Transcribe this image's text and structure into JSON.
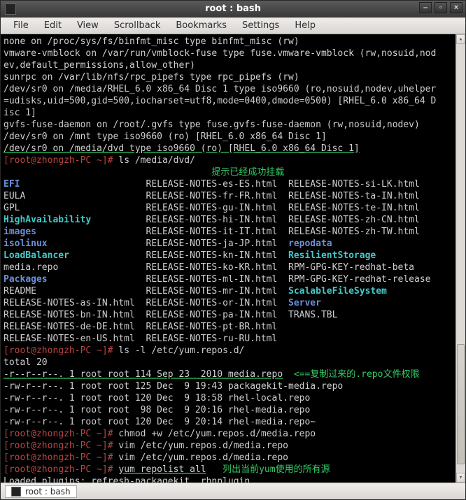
{
  "window": {
    "title": "root : bash"
  },
  "menubar": [
    "File",
    "Edit",
    "View",
    "Scrollback",
    "Bookmarks",
    "Settings",
    "Help"
  ],
  "terminal": {
    "pre_lines": [
      "none on /proc/sys/fs/binfmt_misc type binfmt_misc (rw)",
      "vmware-vmblock on /var/run/vmblock-fuse type fuse.vmware-vmblock (rw,nosuid,nodev,default_permissions,allow_other)",
      "sunrpc on /var/lib/nfs/rpc_pipefs type rpc_pipefs (rw)",
      "/dev/sr0 on /media/RHEL_6.0 x86_64 Disc 1 type iso9660 (ro,nosuid,nodev,uhelper=udisks,uid=500,gid=500,iocharset=utf8,mode=0400,dmode=0500) [RHEL_6.0 x86_64 Disc 1]",
      "gvfs-fuse-daemon on /root/.gvfs type fuse.gvfs-fuse-daemon (rw,nosuid,nodev)",
      "/dev/sr0 on /mnt type iso9660 (ro) [RHEL_6.0 x86_64 Disc 1]"
    ],
    "mount_underlined": "/dev/sr0 on /media/dvd type iso9660 (ro) [RHEL_6.0 x86_64 Disc 1]",
    "prompt1_cmd": "ls /media/dvd/",
    "annotation1_arrow": "<==",
    "annotation1": "提示已经成功挂载",
    "listing": [
      [
        "dir",
        "EFI",
        "plain",
        "RELEASE-NOTES-es-ES.html",
        "plain",
        "RELEASE-NOTES-si-LK.html"
      ],
      [
        "plain",
        "EULA",
        "plain",
        "RELEASE-NOTES-fr-FR.html",
        "plain",
        "RELEASE-NOTES-ta-IN.html"
      ],
      [
        "plain",
        "GPL",
        "plain",
        "RELEASE-NOTES-gu-IN.html",
        "plain",
        "RELEASE-NOTES-te-IN.html"
      ],
      [
        "cyan",
        "HighAvailability",
        "plain",
        "RELEASE-NOTES-hi-IN.html",
        "plain",
        "RELEASE-NOTES-zh-CN.html"
      ],
      [
        "dir",
        "images",
        "plain",
        "RELEASE-NOTES-it-IT.html",
        "plain",
        "RELEASE-NOTES-zh-TW.html"
      ],
      [
        "dir",
        "isolinux",
        "plain",
        "RELEASE-NOTES-ja-JP.html",
        "dir",
        "repodata"
      ],
      [
        "cyan",
        "LoadBalancer",
        "plain",
        "RELEASE-NOTES-kn-IN.html",
        "cyan",
        "ResilientStorage"
      ],
      [
        "plain",
        "media.repo",
        "plain",
        "RELEASE-NOTES-ko-KR.html",
        "plain",
        "RPM-GPG-KEY-redhat-beta"
      ],
      [
        "dir",
        "Packages",
        "plain",
        "RELEASE-NOTES-ml-IN.html",
        "plain",
        "RPM-GPG-KEY-redhat-release"
      ],
      [
        "plain",
        "README",
        "plain",
        "RELEASE-NOTES-mr-IN.html",
        "cyan",
        "ScalableFileSystem"
      ],
      [
        "plain",
        "RELEASE-NOTES-as-IN.html",
        "plain",
        "RELEASE-NOTES-or-IN.html",
        "dir",
        "Server"
      ],
      [
        "plain",
        "RELEASE-NOTES-bn-IN.html",
        "plain",
        "RELEASE-NOTES-pa-IN.html",
        "plain",
        "TRANS.TBL"
      ],
      [
        "plain",
        "RELEASE-NOTES-de-DE.html",
        "plain",
        "RELEASE-NOTES-pt-BR.html",
        "",
        ""
      ],
      [
        "plain",
        "RELEASE-NOTES-en-US.html",
        "plain",
        "RELEASE-NOTES-ru-RU.html",
        "",
        ""
      ]
    ],
    "prompt2_cmd": "ls -l /etc/yum.repos.d/",
    "total_line": "total 20",
    "perm_underlined": "-r--r--r--. 1 root root 114 Sep 23  2010 media.repo",
    "annotation2_arrow": "<==",
    "annotation2": "复制过来的.repo文件权限",
    "perm_lines": [
      "-rw-r--r--. 1 root root 125 Dec  9 19:43 packagekit-media.repo",
      "-rw-r--r--. 1 root root 120 Dec  9 18:58 rhel-local.repo",
      "-rw-r--r--. 1 root root  98 Dec  9 20:16 rhel-media.repo",
      "-rw-r--r--. 1 root root 120 Dec  9 20:14 rhel-media.repo~"
    ],
    "prompt3_cmd": "chmod +w /etc/yum.repos.d/media.repo",
    "prompt4_cmd": "vim /etc/yum.repos.d/media.repo",
    "prompt5_cmd": "vim /etc/yum.repos.d/media.repo",
    "prompt6_cmd": "yum repolist all",
    "annotation3": "列出当前yum使用的所有源",
    "last_line": "Loaded plugins: refresh-packagekit, rhnplugin",
    "prompt_user": "[root@zhongzh-PC ~]# "
  },
  "statusbar": {
    "tab_label": "root : bash"
  },
  "scrollbar": {
    "thumb_top_pct": 70,
    "thumb_height_pct": 28
  }
}
